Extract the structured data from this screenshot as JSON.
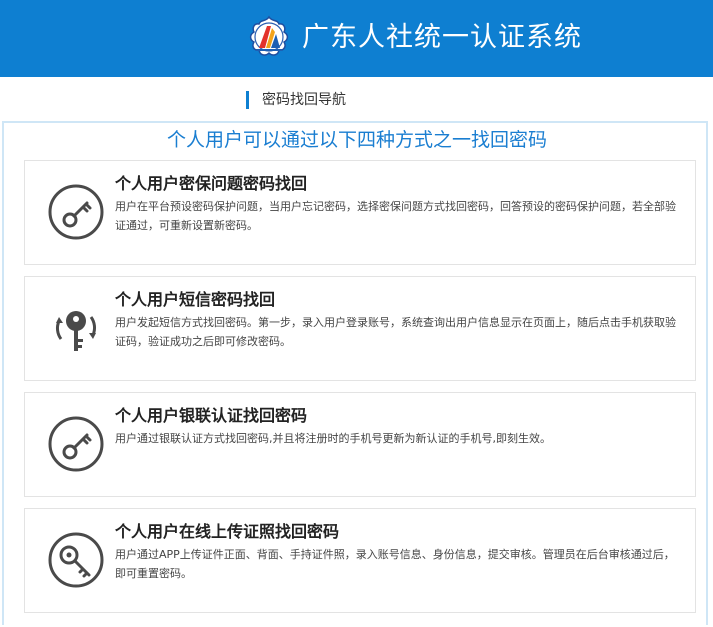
{
  "header": {
    "title": "广东人社统一认证系统",
    "logo_icon": "guangdong-hrss-logo"
  },
  "nav": {
    "label": "密码找回导航"
  },
  "main": {
    "heading": "个人用户可以通过以下四种方式之一找回密码",
    "methods": [
      {
        "icon": "key-icon",
        "title": "个人用户密保问题密码找回",
        "desc": "用户在平台预设密码保护问题，当用户忘记密码，选择密保问题方式找回密码，回答预设的密码保护问题，若全部验证通过，可重新设置新密码。"
      },
      {
        "icon": "refresh-key-icon",
        "title": "个人用户短信密码找回",
        "desc": "用户发起短信方式找回密码。第一步，录入用户登录账号，系统查询出用户信息显示在页面上，随后点击手机获取验证码，验证成功之后即可修改密码。"
      },
      {
        "icon": "key-icon",
        "title": "个人用户银联认证找回密码",
        "desc": "用户通过银联认证方式找回密码,并且将注册时的手机号更新为新认证的手机号,即刻生效。"
      },
      {
        "icon": "key-search-icon",
        "title": "个人用户在线上传证照找回密码",
        "desc": "用户通过APP上传证件正面、背面、手持证件照，录入账号信息、身份信息，提交审核。管理员在后台审核通过后，即可重置密码。"
      }
    ]
  },
  "colors": {
    "brand_blue": "#0e7fd1",
    "heading_blue": "#1a7ed1",
    "icon_gray": "#4a4a4a"
  }
}
